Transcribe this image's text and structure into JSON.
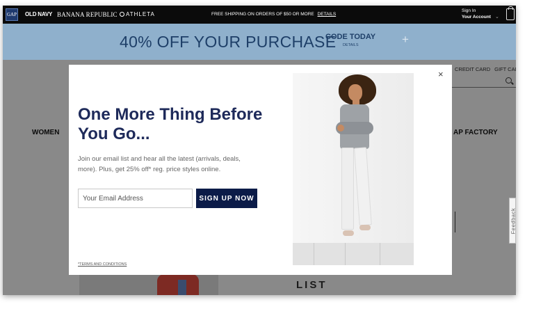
{
  "topbar": {
    "logo_text": "GAP",
    "brands": [
      "OLD NAVY",
      "BANANA REPUBLIC",
      "ATHLETA"
    ],
    "shipping_text": "FREE SHIPPING ON ORDERS OF $50 OR MORE",
    "shipping_details": "DETAILS",
    "signin_label": "Sign In",
    "account_label": "Your Account"
  },
  "banner": {
    "headline": "40% OFF YOUR PURCHASE",
    "code_label": "CODE TODAY",
    "details_label": "DETAILS",
    "plus": "+"
  },
  "background": {
    "credit_card": "CREDIT CARD",
    "gift_card": "GIFT CARD",
    "nav_women": "WOMEN",
    "nav_factory": "AP FACTORY",
    "feedback": "Feedback",
    "list_text": "LIST"
  },
  "modal": {
    "close": "×",
    "heading": "One More Thing Before You Go...",
    "body": "Join our email list and hear all the latest (arrivals, deals, more). Plus, get 25% off* reg. price styles online.",
    "email_placeholder": "Your Email Address",
    "signup_label": "SIGN UP NOW",
    "terms_label": "*TERMS AND CONDITIONS"
  },
  "colors": {
    "banner_bg": "#8fb0cc",
    "banner_text": "#1e3f68",
    "heading": "#1e2a5a",
    "button": "#0b1b48"
  },
  "icons": [
    "gap-logo",
    "bag-icon",
    "search-icon",
    "close-icon",
    "chevron-down-icon"
  ]
}
